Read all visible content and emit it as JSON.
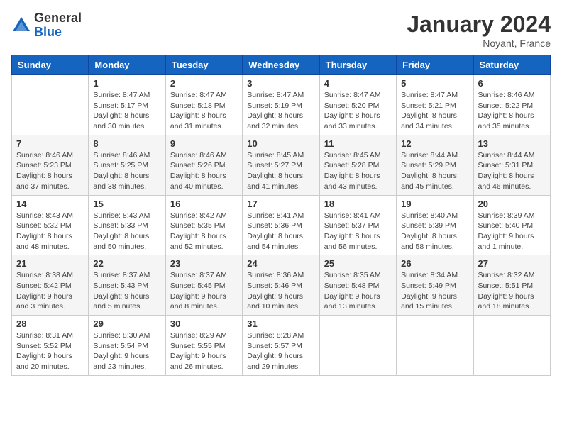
{
  "header": {
    "logo_general": "General",
    "logo_blue": "Blue",
    "month_title": "January 2024",
    "subtitle": "Noyant, France"
  },
  "weekdays": [
    "Sunday",
    "Monday",
    "Tuesday",
    "Wednesday",
    "Thursday",
    "Friday",
    "Saturday"
  ],
  "weeks": [
    [
      {
        "day": "",
        "info": ""
      },
      {
        "day": "1",
        "info": "Sunrise: 8:47 AM\nSunset: 5:17 PM\nDaylight: 8 hours\nand 30 minutes."
      },
      {
        "day": "2",
        "info": "Sunrise: 8:47 AM\nSunset: 5:18 PM\nDaylight: 8 hours\nand 31 minutes."
      },
      {
        "day": "3",
        "info": "Sunrise: 8:47 AM\nSunset: 5:19 PM\nDaylight: 8 hours\nand 32 minutes."
      },
      {
        "day": "4",
        "info": "Sunrise: 8:47 AM\nSunset: 5:20 PM\nDaylight: 8 hours\nand 33 minutes."
      },
      {
        "day": "5",
        "info": "Sunrise: 8:47 AM\nSunset: 5:21 PM\nDaylight: 8 hours\nand 34 minutes."
      },
      {
        "day": "6",
        "info": "Sunrise: 8:46 AM\nSunset: 5:22 PM\nDaylight: 8 hours\nand 35 minutes."
      }
    ],
    [
      {
        "day": "7",
        "info": "Sunrise: 8:46 AM\nSunset: 5:23 PM\nDaylight: 8 hours\nand 37 minutes."
      },
      {
        "day": "8",
        "info": "Sunrise: 8:46 AM\nSunset: 5:25 PM\nDaylight: 8 hours\nand 38 minutes."
      },
      {
        "day": "9",
        "info": "Sunrise: 8:46 AM\nSunset: 5:26 PM\nDaylight: 8 hours\nand 40 minutes."
      },
      {
        "day": "10",
        "info": "Sunrise: 8:45 AM\nSunset: 5:27 PM\nDaylight: 8 hours\nand 41 minutes."
      },
      {
        "day": "11",
        "info": "Sunrise: 8:45 AM\nSunset: 5:28 PM\nDaylight: 8 hours\nand 43 minutes."
      },
      {
        "day": "12",
        "info": "Sunrise: 8:44 AM\nSunset: 5:29 PM\nDaylight: 8 hours\nand 45 minutes."
      },
      {
        "day": "13",
        "info": "Sunrise: 8:44 AM\nSunset: 5:31 PM\nDaylight: 8 hours\nand 46 minutes."
      }
    ],
    [
      {
        "day": "14",
        "info": "Sunrise: 8:43 AM\nSunset: 5:32 PM\nDaylight: 8 hours\nand 48 minutes."
      },
      {
        "day": "15",
        "info": "Sunrise: 8:43 AM\nSunset: 5:33 PM\nDaylight: 8 hours\nand 50 minutes."
      },
      {
        "day": "16",
        "info": "Sunrise: 8:42 AM\nSunset: 5:35 PM\nDaylight: 8 hours\nand 52 minutes."
      },
      {
        "day": "17",
        "info": "Sunrise: 8:41 AM\nSunset: 5:36 PM\nDaylight: 8 hours\nand 54 minutes."
      },
      {
        "day": "18",
        "info": "Sunrise: 8:41 AM\nSunset: 5:37 PM\nDaylight: 8 hours\nand 56 minutes."
      },
      {
        "day": "19",
        "info": "Sunrise: 8:40 AM\nSunset: 5:39 PM\nDaylight: 8 hours\nand 58 minutes."
      },
      {
        "day": "20",
        "info": "Sunrise: 8:39 AM\nSunset: 5:40 PM\nDaylight: 9 hours\nand 1 minute."
      }
    ],
    [
      {
        "day": "21",
        "info": "Sunrise: 8:38 AM\nSunset: 5:42 PM\nDaylight: 9 hours\nand 3 minutes."
      },
      {
        "day": "22",
        "info": "Sunrise: 8:37 AM\nSunset: 5:43 PM\nDaylight: 9 hours\nand 5 minutes."
      },
      {
        "day": "23",
        "info": "Sunrise: 8:37 AM\nSunset: 5:45 PM\nDaylight: 9 hours\nand 8 minutes."
      },
      {
        "day": "24",
        "info": "Sunrise: 8:36 AM\nSunset: 5:46 PM\nDaylight: 9 hours\nand 10 minutes."
      },
      {
        "day": "25",
        "info": "Sunrise: 8:35 AM\nSunset: 5:48 PM\nDaylight: 9 hours\nand 13 minutes."
      },
      {
        "day": "26",
        "info": "Sunrise: 8:34 AM\nSunset: 5:49 PM\nDaylight: 9 hours\nand 15 minutes."
      },
      {
        "day": "27",
        "info": "Sunrise: 8:32 AM\nSunset: 5:51 PM\nDaylight: 9 hours\nand 18 minutes."
      }
    ],
    [
      {
        "day": "28",
        "info": "Sunrise: 8:31 AM\nSunset: 5:52 PM\nDaylight: 9 hours\nand 20 minutes."
      },
      {
        "day": "29",
        "info": "Sunrise: 8:30 AM\nSunset: 5:54 PM\nDaylight: 9 hours\nand 23 minutes."
      },
      {
        "day": "30",
        "info": "Sunrise: 8:29 AM\nSunset: 5:55 PM\nDaylight: 9 hours\nand 26 minutes."
      },
      {
        "day": "31",
        "info": "Sunrise: 8:28 AM\nSunset: 5:57 PM\nDaylight: 9 hours\nand 29 minutes."
      },
      {
        "day": "",
        "info": ""
      },
      {
        "day": "",
        "info": ""
      },
      {
        "day": "",
        "info": ""
      }
    ]
  ]
}
